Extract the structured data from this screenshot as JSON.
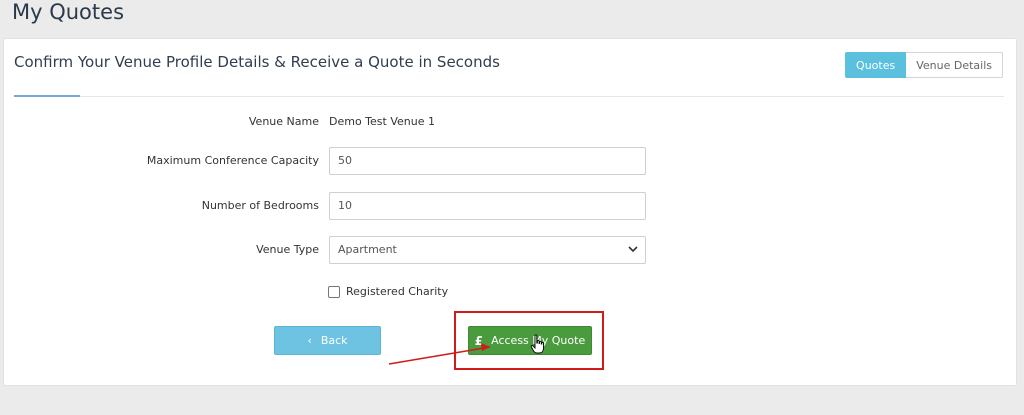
{
  "page": {
    "title": "My Quotes"
  },
  "panel": {
    "heading": "Confirm Your Venue Profile Details & Receive a Quote in Seconds",
    "tabs": [
      {
        "label": "Quotes",
        "active": true
      },
      {
        "label": "Venue Details",
        "active": false
      }
    ]
  },
  "form": {
    "venue_name": {
      "label": "Venue Name",
      "value": "Demo Test Venue 1"
    },
    "capacity": {
      "label": "Maximum Conference Capacity",
      "value": "50"
    },
    "bedrooms": {
      "label": "Number of Bedrooms",
      "value": "10"
    },
    "venue_type": {
      "label": "Venue Type",
      "value": "Apartment"
    },
    "charity": {
      "label": "Registered Charity",
      "checked": false
    }
  },
  "actions": {
    "back_label": "Back",
    "quote_label": "Access My Quote",
    "quote_icon": "£"
  },
  "colors": {
    "accent": "#5bc0de",
    "success": "#4a9a3e",
    "annotation": "#d01b1b"
  },
  "icons": {
    "back": "chevron-left-icon",
    "select": "chevron-down-icon",
    "cursor": "hand-pointer-icon"
  }
}
